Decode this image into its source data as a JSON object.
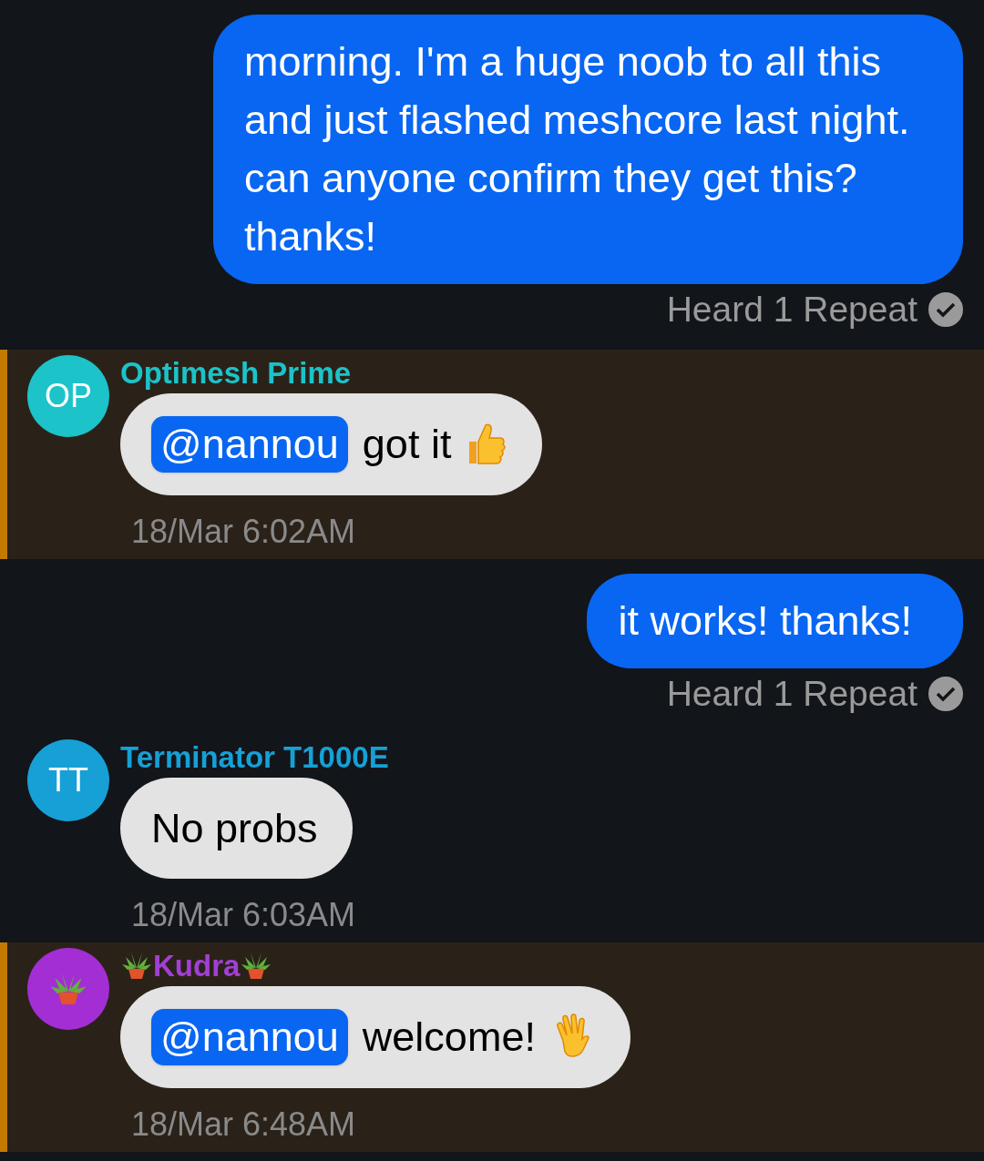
{
  "messages": [
    {
      "kind": "sent",
      "text": "morning. I'm a huge noob to all this and just flashed meshcore last night. can anyone confirm they get this? thanks!",
      "status": "Heard 1 Repeat",
      "delivered": true
    },
    {
      "kind": "received",
      "highlighted": true,
      "author": "Optimesh Prime",
      "color": "#1cc3c9",
      "avatar": {
        "kind": "initials",
        "initials": "OP",
        "color": "#1cc3c9"
      },
      "mention": "@nannou",
      "text": "got it",
      "trailing": {
        "kind": "thumbs-up"
      },
      "time": "18/Mar 6:02AM"
    },
    {
      "kind": "sent",
      "text": "it works! thanks!",
      "status": "Heard 1 Repeat",
      "delivered": true
    },
    {
      "kind": "received",
      "highlighted": false,
      "author": "Terminator T1000E",
      "color": "#16a0d6",
      "avatar": {
        "kind": "initials",
        "initials": "TT",
        "color": "#16a0d6"
      },
      "text": "No probs",
      "time": "18/Mar 6:03AM"
    },
    {
      "kind": "received",
      "highlighted": true,
      "author": "Kudra",
      "color": "#a23fd4",
      "name_decorated": true,
      "avatar": {
        "kind": "plant",
        "color": "#a32ed4"
      },
      "mention": "@nannou",
      "text": "welcome!",
      "trailing": {
        "kind": "waving-hand"
      },
      "time": "18/Mar 6:48AM"
    }
  ]
}
